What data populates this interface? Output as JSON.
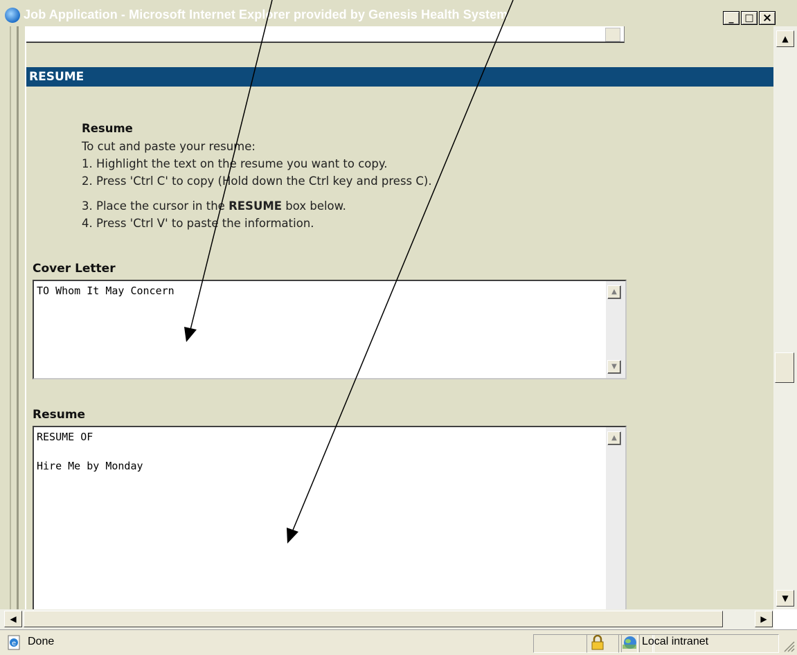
{
  "window": {
    "title": "Job Application - Microsoft Internet Explorer provided by Genesis Health System",
    "controls": {
      "minimize": "_",
      "maximize": "□",
      "close": "×"
    }
  },
  "section": {
    "title": "RESUME"
  },
  "instructions": {
    "heading": "Resume",
    "intro": "To cut and paste your resume:",
    "step1": "1. Highlight the text on the resume you want to copy.",
    "step2": "2. Press 'Ctrl C' to copy (Hold down the Ctrl key and press C).",
    "step3_before": "3. Place the cursor in the ",
    "step3_bold": "RESUME",
    "step3_after": " box below.",
    "step4": "4. Press 'Ctrl V' to paste the information."
  },
  "cover_letter": {
    "label": "Cover Letter",
    "value": "TO Whom It May Concern"
  },
  "resume": {
    "label": "Resume",
    "value": "RESUME OF\n\nHire Me by Monday"
  },
  "statusbar": {
    "status": "Done",
    "zone": "Local intranet"
  },
  "icons": {
    "title": "ie-logo-icon",
    "status": "ie-page-icon",
    "lock": "padlock-icon",
    "zone": "intranet-globe-icon"
  },
  "colors": {
    "section_header": "#0d4a7a",
    "page_background": "#dfdfc7",
    "titlebar": "#dfdfc7"
  }
}
